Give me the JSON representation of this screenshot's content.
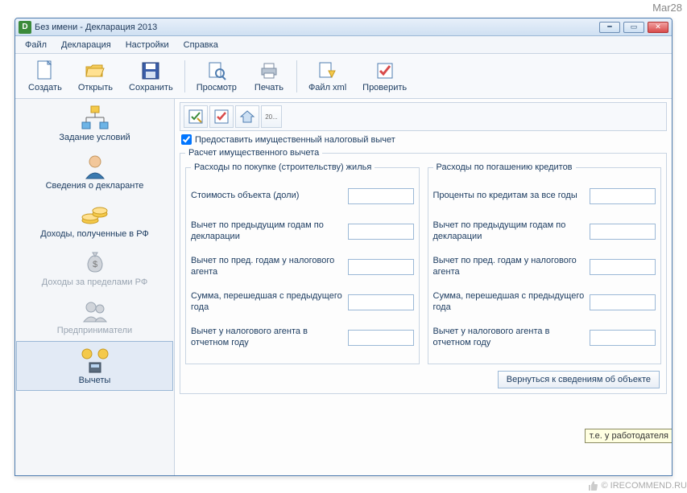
{
  "watermark_tr": "Mar28",
  "watermark_br": "© IRECOMMEND.RU",
  "window": {
    "title": "Без имени - Декларация 2013",
    "app_icon_letter": "D"
  },
  "menu": {
    "file": "Файл",
    "decl": "Декларация",
    "settings": "Настройки",
    "help": "Справка"
  },
  "toolbar": {
    "create": "Создать",
    "open": "Открыть",
    "save": "Сохранить",
    "preview": "Просмотр",
    "print": "Печать",
    "xml": "Файл xml",
    "check": "Проверить"
  },
  "sidebar": {
    "conditions": "Задание условий",
    "declarant": "Сведения о декларанте",
    "income_rf": "Доходы, полученные в РФ",
    "income_abroad": "Доходы за пределами РФ",
    "entrepreneurs": "Предприниматели",
    "deductions": "Вычеты"
  },
  "subtoolbar": {
    "btn20": "20..."
  },
  "checkbox_label": "Предоставить имущественный налоговый вычет",
  "fieldset_title": "Расчет имущественного вычета",
  "col_left_title": "Расходы по покупке (строительству) жилья",
  "col_right_title": "Расходы по погашению кредитов",
  "left": {
    "f0": "Стоимость объекта (доли)",
    "f1": "Вычет по предыдущим годам по декларации",
    "f2": "Вычет по пред. годам у налогового агента",
    "f3": "Сумма, перешедшая с предыдущего года",
    "f4": "Вычет у налогового агента в отчетном году"
  },
  "right": {
    "f0": "Проценты по кредитам за все годы",
    "f1": "Вычет по предыдущим годам по декларации",
    "f2": "Вычет по пред. годам у налогового агента",
    "f3": "Сумма, перешедшая с предыдущего года",
    "f4": "Вычет у налогового агента в отчетном году"
  },
  "tooltip": "т.е. у работодателя",
  "back_button": "Вернуться к сведениям об объекте"
}
